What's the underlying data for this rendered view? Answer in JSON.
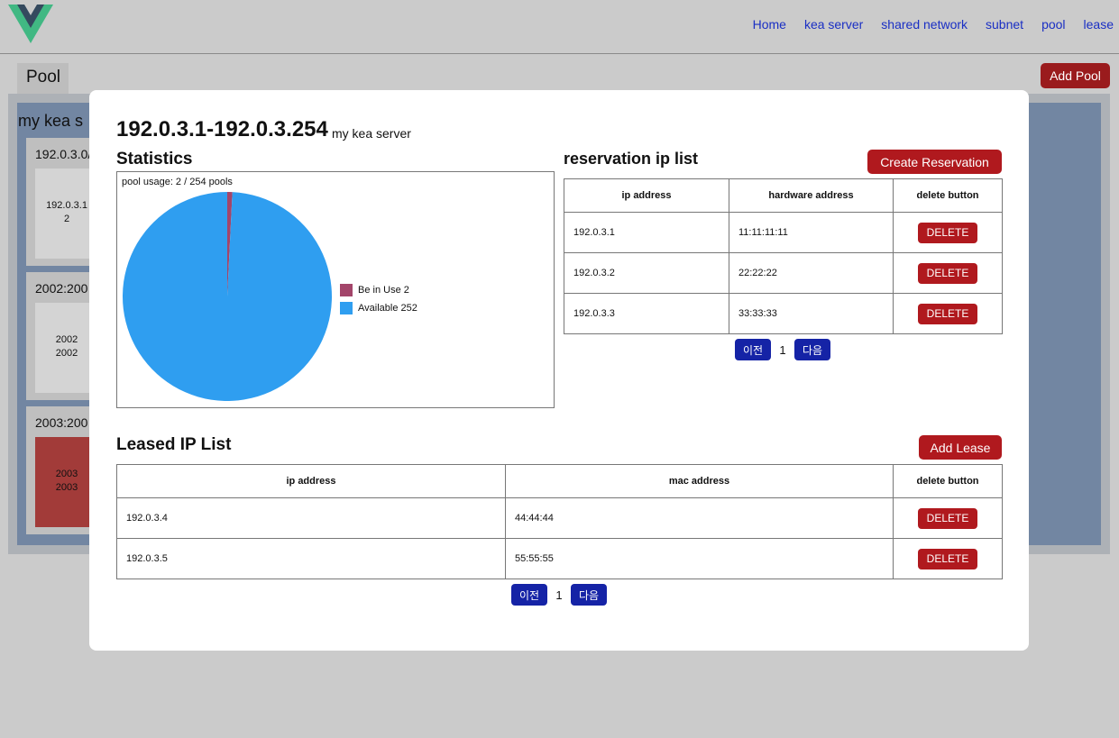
{
  "nav": {
    "items": [
      "Home",
      "kea server",
      "shared network",
      "subnet",
      "pool",
      "lease"
    ]
  },
  "background": {
    "tab_label": "Pool",
    "add_pool_label": "Add Pool",
    "server_title": "my kea s",
    "cards": [
      {
        "title": "192.0.3.0/",
        "line1": "192.0.3.1",
        "line2": "2"
      },
      {
        "title": "2002:200",
        "line1": "2002",
        "line2": "2002"
      },
      {
        "title": "2003:200",
        "line1": "2003",
        "line2": "2003"
      }
    ]
  },
  "modal": {
    "title": "192.0.3.1-192.0.3.254",
    "server": "my kea server",
    "statistics_title": "Statistics",
    "pool_usage": "pool usage: 2 / 254 pools",
    "legend": [
      {
        "label": "Be in Use",
        "value": "2",
        "color": "#a3456a"
      },
      {
        "label": "Available",
        "value": "252",
        "color": "#2f9ef0"
      }
    ],
    "reservation": {
      "title": "reservation ip list",
      "create_label": "Create Reservation",
      "headers": [
        "ip address",
        "hardware address",
        "delete button"
      ],
      "rows": [
        {
          "ip": "192.0.3.1",
          "hw": "11:11:11:11",
          "action": "DELETE"
        },
        {
          "ip": "192.0.3.2",
          "hw": "22:22:22",
          "action": "DELETE"
        },
        {
          "ip": "192.0.3.3",
          "hw": "33:33:33",
          "action": "DELETE"
        }
      ],
      "prev": "이전",
      "page": "1",
      "next": "다음"
    },
    "leased": {
      "title": "Leased IP List",
      "add_label": "Add Lease",
      "headers": [
        "ip address",
        "mac address",
        "delete button"
      ],
      "rows": [
        {
          "ip": "192.0.3.4",
          "mac": "44:44:44",
          "action": "DELETE"
        },
        {
          "ip": "192.0.3.5",
          "mac": "55:55:55",
          "action": "DELETE"
        }
      ],
      "prev": "이전",
      "page": "1",
      "next": "다음"
    }
  },
  "chart_data": {
    "type": "pie",
    "title": "pool usage: 2 / 254 pools",
    "categories": [
      "Be in Use",
      "Available"
    ],
    "values": [
      2,
      252
    ],
    "colors": [
      "#a3456a",
      "#2f9ef0"
    ],
    "legend": "right"
  }
}
